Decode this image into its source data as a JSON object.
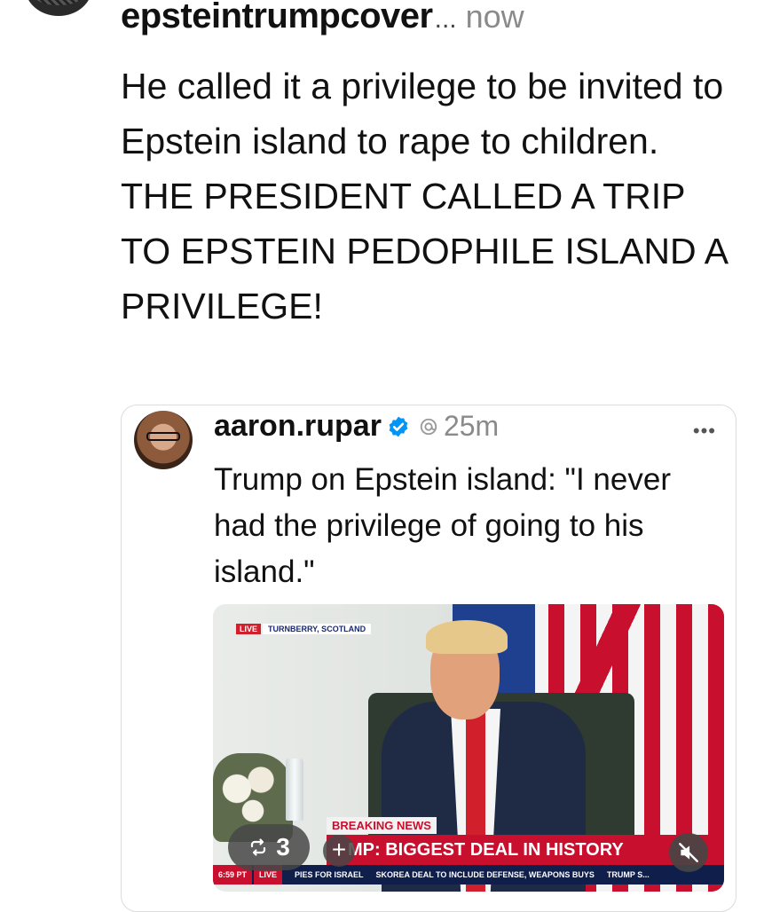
{
  "post": {
    "username": "epsteintrumpcover",
    "truncation": "...",
    "time": "now",
    "lines": [
      "He called it a privilege to be invited to Epstein island to rape to children.",
      "THE PRESIDENT CALLED A TRIP TO EPSTEIN PEDOPHILE ISLAND A PRIVILEGE!"
    ]
  },
  "quote": {
    "username": "aaron.rupar",
    "time": "25m",
    "text": "Trump on Epstein island: \"I never had the privilege of going to his island.\"",
    "more_icon": "more-icon",
    "verified_icon": "verified-icon",
    "threads_icon": "threads-icon"
  },
  "video": {
    "live_badge": "LIVE",
    "location": "TURNBERRY, SCOTLAND",
    "breaking": "BREAKING NEWS",
    "headline": "MP: BIGGEST DEAL IN HISTORY",
    "ticker": {
      "clock": "6:59 PT",
      "live": "LIVE",
      "items": [
        "PIES FOR ISRAEL",
        "SKOREA DEAL TO INCLUDE DEFENSE, WEAPONS BUYS",
        "TRUMP S..."
      ]
    },
    "repost_count": "3",
    "plus": "+"
  },
  "colors": {
    "accent_red": "#c8102e",
    "verified_blue": "#0095f6",
    "ticker_navy": "#0f1e4b"
  }
}
